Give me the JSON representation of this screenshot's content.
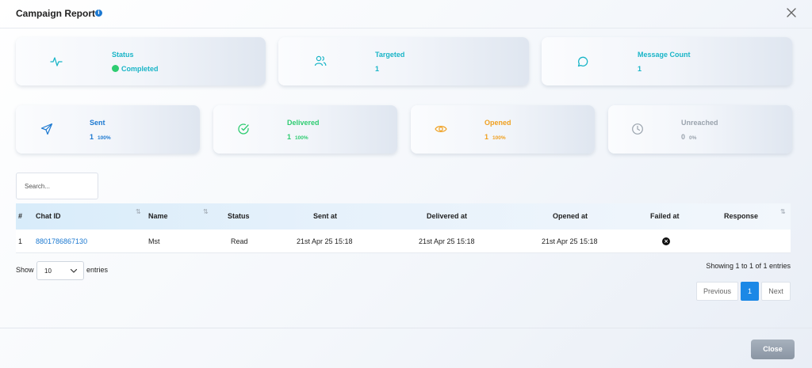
{
  "modal": {
    "title": "Campaign Report",
    "info_icon": "info-icon",
    "close_icon": "close-icon"
  },
  "summary_cards": {
    "status": {
      "label": "Status",
      "value": "Completed",
      "icon": "activity-icon",
      "color": "#19b5c7",
      "value_color": "#2ecc71"
    },
    "targeted": {
      "label": "Targeted",
      "value": "1",
      "icon": "users-icon",
      "color": "#19b5c7"
    },
    "message_count": {
      "label": "Message Count",
      "value": "1",
      "icon": "message-circle-icon",
      "color": "#19b5c7"
    }
  },
  "stat_cards": {
    "sent": {
      "label": "Sent",
      "value": "1",
      "percent": "100%",
      "icon": "send-icon",
      "color": "#1b78d0"
    },
    "delivered": {
      "label": "Delivered",
      "value": "1",
      "percent": "100%",
      "icon": "check-circle-icon",
      "color": "#2ecc71"
    },
    "opened": {
      "label": "Opened",
      "value": "1",
      "percent": "100%",
      "icon": "eye-icon",
      "color": "#f0a020"
    },
    "unreached": {
      "label": "Unreached",
      "value": "0",
      "percent": "0%",
      "icon": "clock-icon",
      "color": "#9aa3ad"
    }
  },
  "search": {
    "placeholder": "Search..."
  },
  "table": {
    "columns": [
      "#",
      "Chat ID",
      "Name",
      "Status",
      "Sent at",
      "Delivered at",
      "Opened at",
      "Failed at",
      "Response"
    ],
    "rows": [
      {
        "index": "1",
        "chat_id": "8801786867130",
        "name": "Mst",
        "status": "Read",
        "sent_at": "21st Apr 25 15:18",
        "delivered_at": "21st Apr 25 15:18",
        "opened_at": "21st Apr 25 15:18",
        "failed_icon": "x-circle-icon",
        "response": ""
      }
    ]
  },
  "length_menu": {
    "show_label": "Show",
    "value": "10",
    "entries_label": "entries"
  },
  "info_text": "Showing 1 to 1 of 1 entries",
  "pagination": {
    "previous": "Previous",
    "current": "1",
    "next": "Next"
  },
  "footer": {
    "close_label": "Close"
  }
}
